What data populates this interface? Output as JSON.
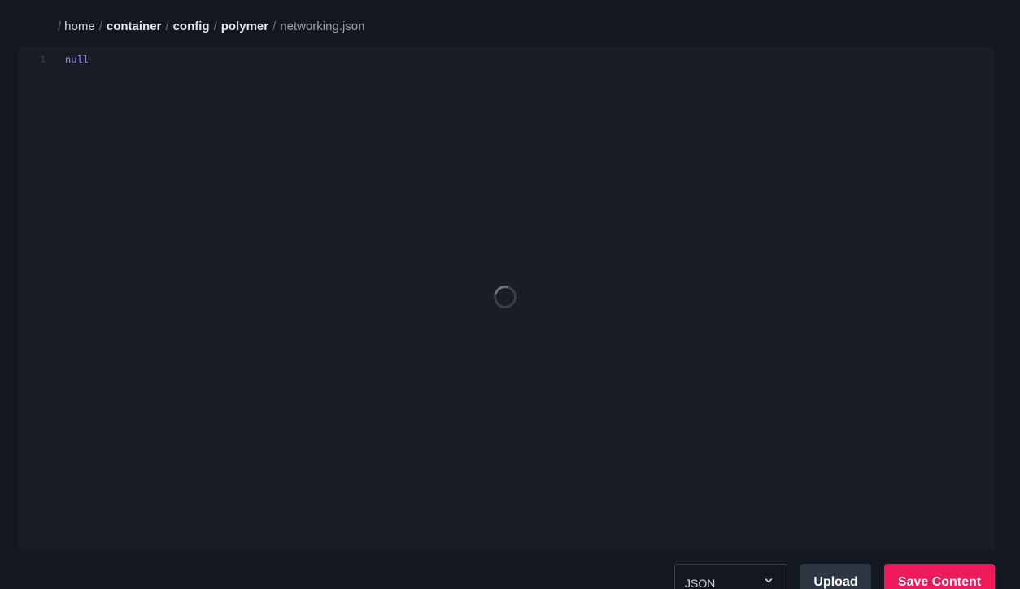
{
  "breadcrumb": {
    "separator": "/",
    "items": [
      "home",
      "container",
      "config",
      "polymer"
    ],
    "current": "networking.json"
  },
  "editor": {
    "lines": [
      {
        "number": "1",
        "text": "null"
      }
    ],
    "loading": true
  },
  "footer": {
    "language_select": {
      "value": "JSON"
    },
    "upload_label": "Upload",
    "save_label": "Save Content"
  },
  "colors": {
    "background": "#131720",
    "editor_bg": "#1a1d27",
    "code_keyword": "#a78bfa",
    "save_button": "#f0195c",
    "upload_button": "#2d3744"
  }
}
